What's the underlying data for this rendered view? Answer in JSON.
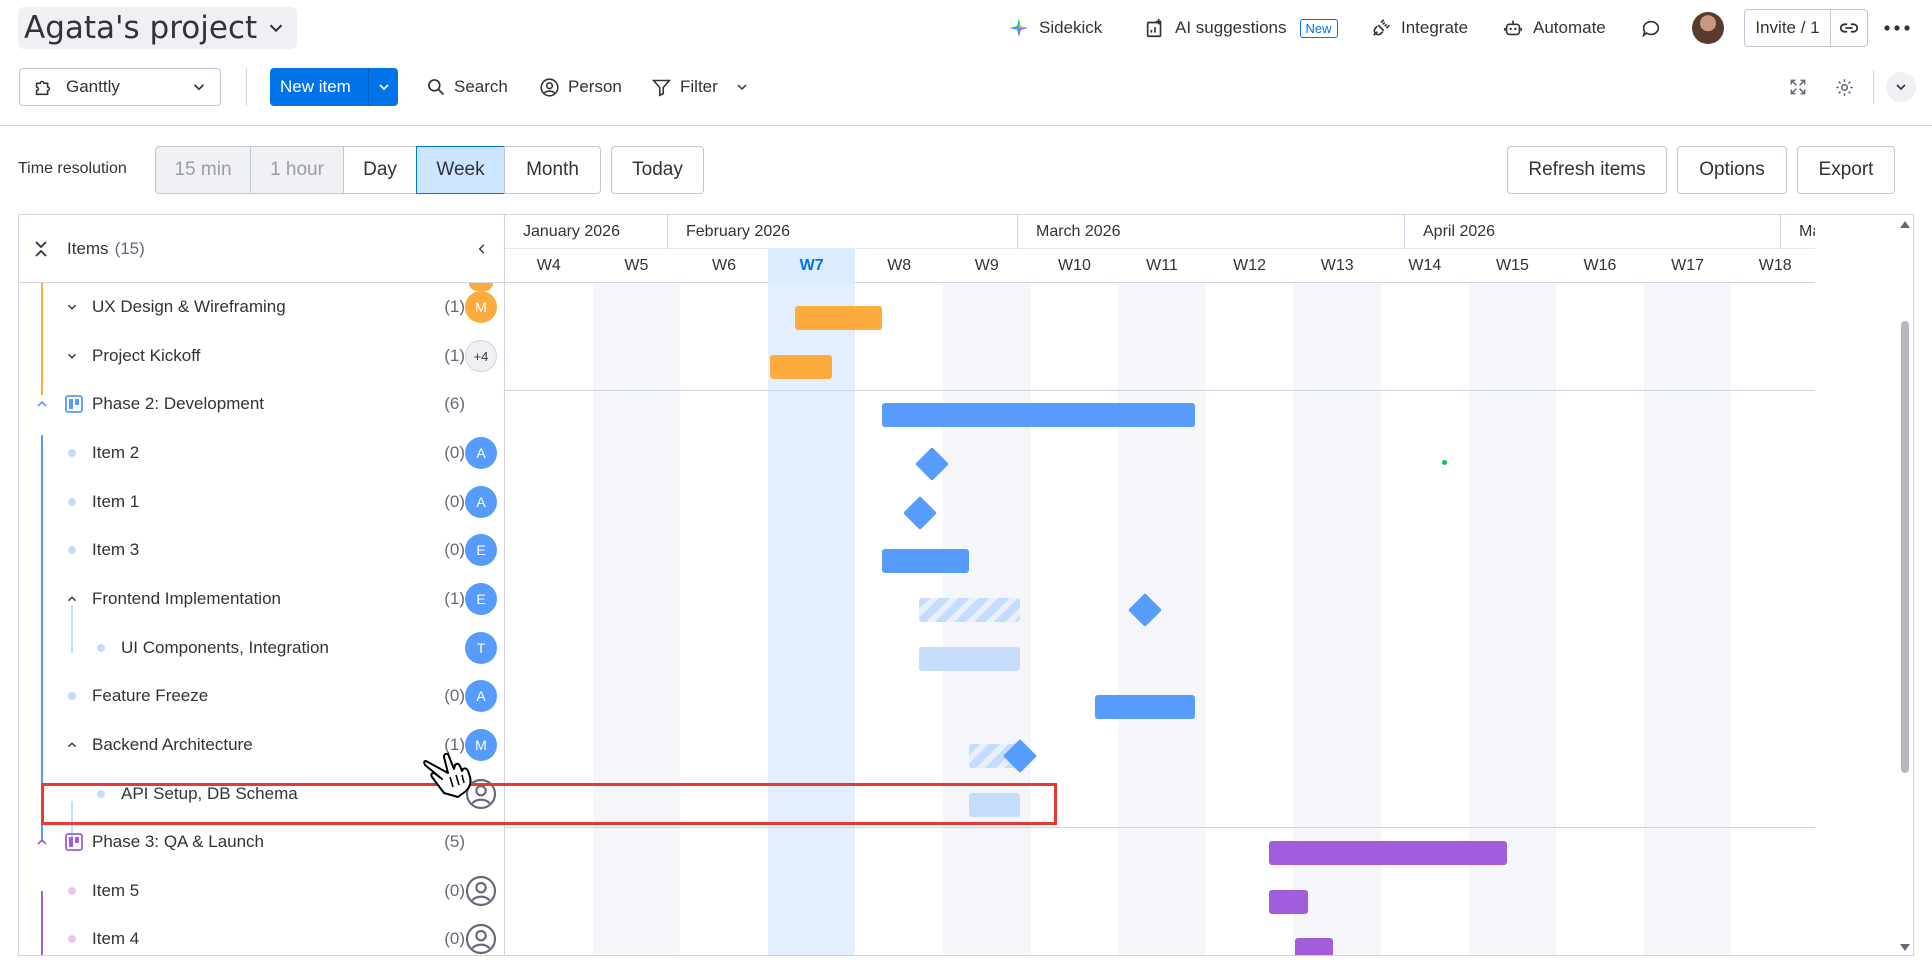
{
  "header": {
    "project_title": "Agata's project",
    "sidekick": "Sidekick",
    "ai_suggestions": "AI suggestions",
    "new_badge": "New",
    "integrate": "Integrate",
    "automate": "Automate",
    "invite": "Invite / 1"
  },
  "toolbar": {
    "view_name": "Ganttly",
    "new_item": "New item",
    "search": "Search",
    "person": "Person",
    "filter": "Filter"
  },
  "time_resolution": {
    "label": "Time resolution",
    "options": [
      "15 min",
      "1 hour",
      "Day",
      "Week",
      "Month"
    ],
    "selected": "Week",
    "today": "Today",
    "refresh": "Refresh items",
    "options_btn": "Options",
    "export": "Export"
  },
  "left_pane": {
    "items_label": "Items",
    "items_count": "(15)",
    "rows": [
      {
        "label": "UX Design & Wireframing",
        "count": "(1)",
        "avatar": "M"
      },
      {
        "label": "Project Kickoff",
        "count": "(1)",
        "avatar": "+4"
      },
      {
        "label": "Phase 2: Development",
        "count": "(6)",
        "avatar": ""
      },
      {
        "label": "Item 2",
        "count": "(0)",
        "avatar": "A"
      },
      {
        "label": "Item 1",
        "count": "(0)",
        "avatar": "A"
      },
      {
        "label": "Item 3",
        "count": "(0)",
        "avatar": "E"
      },
      {
        "label": "Frontend Implementation",
        "count": "(1)",
        "avatar": "E"
      },
      {
        "label": "UI Components, Integration",
        "count": "",
        "avatar": "T"
      },
      {
        "label": "Feature Freeze",
        "count": "(0)",
        "avatar": "A"
      },
      {
        "label": "Backend Architecture",
        "count": "(1)",
        "avatar": "M"
      },
      {
        "label": "API Setup, DB Schema",
        "count": "",
        "avatar": ""
      },
      {
        "label": "Phase 3: QA & Launch",
        "count": "(5)",
        "avatar": ""
      },
      {
        "label": "Item 5",
        "count": "(0)",
        "avatar": ""
      },
      {
        "label": "Item 4",
        "count": "(0)",
        "avatar": ""
      }
    ]
  },
  "timeline": {
    "months": [
      "January 2026",
      "February 2026",
      "March 2026",
      "April 2026",
      "Ma"
    ],
    "weeks": [
      "W4",
      "W5",
      "W6",
      "W7",
      "W8",
      "W9",
      "W10",
      "W11",
      "W12",
      "W13",
      "W14",
      "W15",
      "W16",
      "W17",
      "W18"
    ],
    "current_week": "W7"
  },
  "colors": {
    "accent": "#0073ea",
    "phase1": "#fdab3d",
    "phase2": "#579bfc",
    "phase3": "#a25ddc",
    "highlight": "#e53935"
  }
}
